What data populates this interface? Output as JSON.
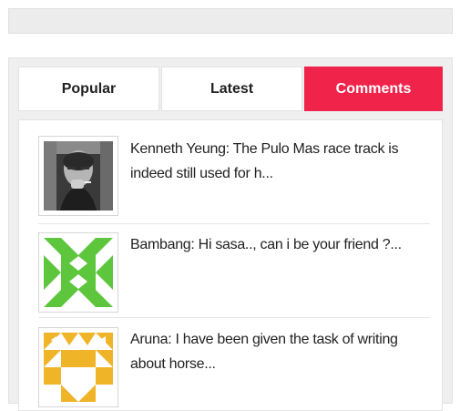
{
  "tabs": [
    {
      "label": "Popular",
      "active": false
    },
    {
      "label": "Latest",
      "active": false
    },
    {
      "label": "Comments",
      "active": true
    }
  ],
  "accent_color": "#f0234a",
  "comments": [
    {
      "text": "Kenneth Yeung: The Pulo Mas race track is indeed still used for h...",
      "avatar": "user-photo-avatar"
    },
    {
      "text": "Bambang: Hi sasa.., can i be your friend ?...",
      "avatar": "green-identicon-avatar",
      "avatar_color": "#5ec63c"
    },
    {
      "text": "Aruna: I have been given the task of writing about horse...",
      "avatar": "orange-identicon-avatar",
      "avatar_color": "#f0b429"
    }
  ]
}
